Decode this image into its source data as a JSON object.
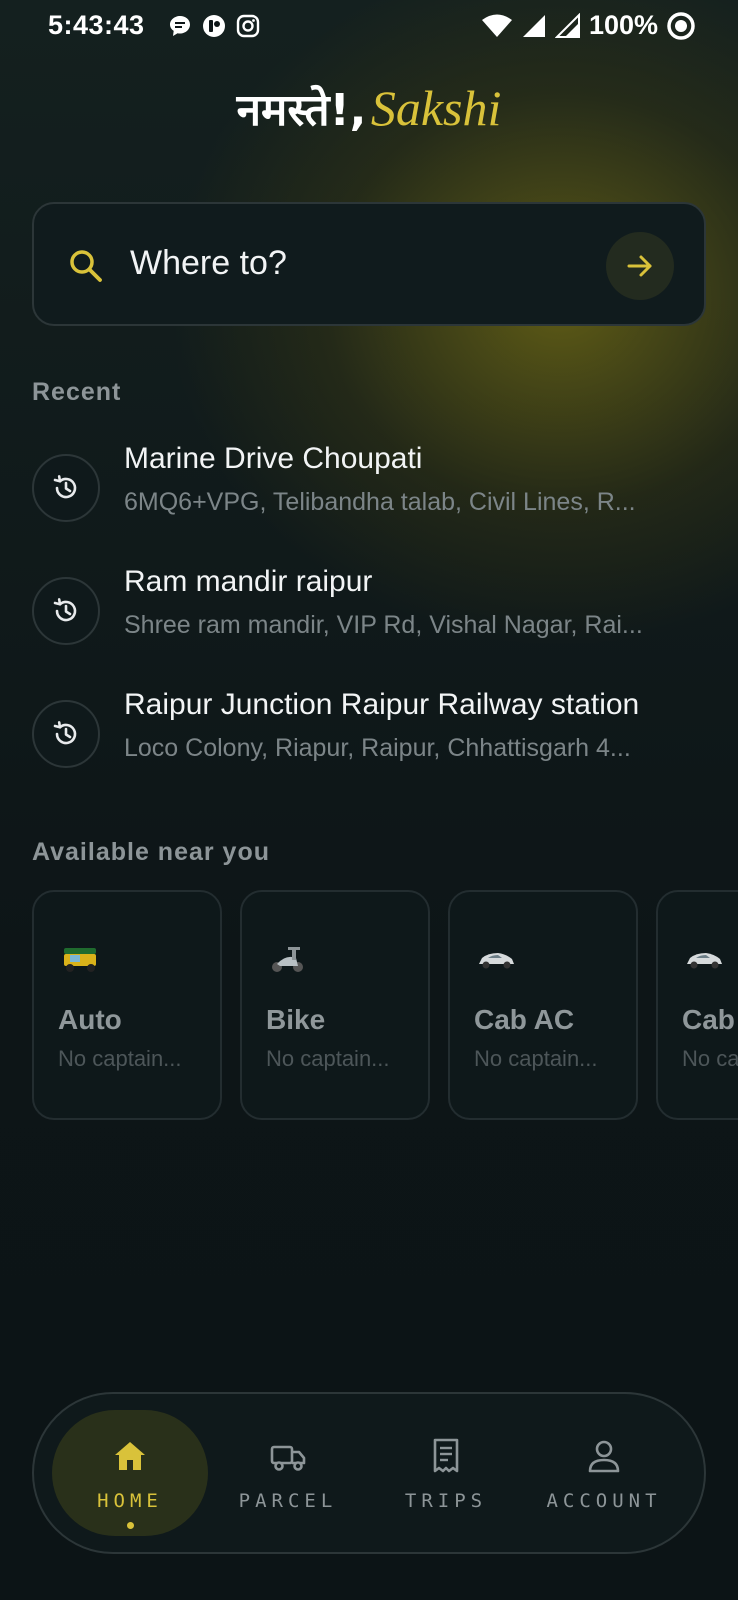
{
  "status_bar": {
    "time": "5:43:43",
    "battery": "100%"
  },
  "greeting": {
    "prefix": "नमस्ते!,",
    "name": "Sakshi"
  },
  "search": {
    "placeholder": "Where to?"
  },
  "recent": {
    "heading": "Recent",
    "items": [
      {
        "title": "Marine Drive Choupati",
        "subtitle": "6MQ6+VPG, Telibandha talab, Civil Lines, R..."
      },
      {
        "title": "Ram mandir raipur",
        "subtitle": "Shree ram mandir, VIP Rd, Vishal Nagar, Rai..."
      },
      {
        "title": "Raipur Junction Raipur Railway station",
        "subtitle": "Loco Colony, Riapur, Raipur, Chhattisgarh 4..."
      }
    ]
  },
  "available": {
    "heading": "Available near you",
    "vehicles": [
      {
        "name": "Auto",
        "status": "No captain...",
        "icon": "auto-rickshaw-icon"
      },
      {
        "name": "Bike",
        "status": "No captain...",
        "icon": "scooter-icon"
      },
      {
        "name": "Cab AC",
        "status": "No captain...",
        "icon": "car-icon"
      },
      {
        "name": "Cab",
        "status": "No ca",
        "icon": "car-icon"
      }
    ]
  },
  "nav": {
    "items": [
      {
        "label": "HOME",
        "icon": "home-icon",
        "active": true
      },
      {
        "label": "PARCEL",
        "icon": "truck-icon",
        "active": false
      },
      {
        "label": "TRIPS",
        "icon": "receipt-icon",
        "active": false
      },
      {
        "label": "ACCOUNT",
        "icon": "user-icon",
        "active": false
      }
    ]
  },
  "colors": {
    "accent": "#d9c23a",
    "background": "#0d1517",
    "card_border": "#2c3638"
  }
}
